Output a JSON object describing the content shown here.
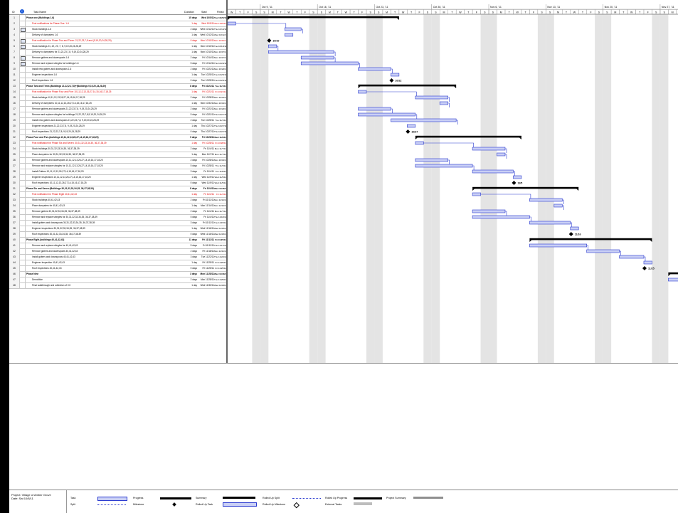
{
  "header": {
    "id": "ID",
    "task_name": "Task Name",
    "duration": "Duration",
    "start": "Start",
    "finish": "Finish"
  },
  "timescale": {
    "weeks": [
      "Oct 9, '11",
      "Oct 16, '11",
      "Oct 23, '11",
      "Oct 30, '11",
      "Nov 6, '11",
      "Nov 13, '11",
      "Nov 20, '11",
      "Nov 27, '11"
    ],
    "day_letters": [
      "W",
      "T",
      "F",
      "S",
      "S",
      "M",
      "T",
      "W",
      "T",
      "F",
      "S",
      "S",
      "M",
      "T",
      "W",
      "T",
      "F",
      "S",
      "S",
      "M",
      "T",
      "W",
      "T",
      "F",
      "S",
      "S",
      "M",
      "T",
      "W",
      "T",
      "F",
      "S",
      "S",
      "M",
      "T",
      "W",
      "T",
      "F",
      "S",
      "S",
      "M",
      "T",
      "W",
      "T",
      "F",
      "S",
      "S",
      "M",
      "T",
      "W",
      "T",
      "F",
      "S",
      "S",
      "M",
      "T",
      "W"
    ]
  },
  "tasks": [
    {
      "id": "1",
      "name": "Phase one-(Buildings 1-6)",
      "dur": "15 days",
      "start": "Wed 10/5/11",
      "finish": "Tue 10/25/11",
      "type": "summary",
      "indent": 0,
      "icon": false
    },
    {
      "id": "2",
      "name": "Post notifications for Phase One. 1-6",
      "dur": "1 day",
      "start": "Wed 10/5/11",
      "finish": "Wed 10/5/11",
      "type": "red",
      "indent": 1,
      "icon": false
    },
    {
      "id": "3",
      "name": "Stock buildings 1-6",
      "dur": "2 days",
      "start": "Wed 10/12/11",
      "finish": "Thu 10/13/11",
      "type": "task",
      "indent": 1,
      "icon": true
    },
    {
      "id": "4",
      "name": "Delivery of dumpsters 1-6",
      "dur": "1 day",
      "start": "Wed 10/12/11",
      "finish": "Wed 10/12/11",
      "type": "task",
      "indent": 1,
      "icon": false
    },
    {
      "id": "5",
      "name": "Post notification for Phase Two and Three: 21,22,23,7,8 and (9,19,20,24,28,29)",
      "dur": "0 days",
      "start": "Mon 10/10/11",
      "finish": "Mon 10/10/11",
      "type": "red",
      "indent": 1,
      "icon": true
    },
    {
      "id": "6",
      "name": "Stock buildings 21, 22, 23, 7, 8, 9,19,20,24,28,29",
      "dur": "1 day",
      "start": "Mon 10/10/11",
      "finish": "Tue 10/10/11",
      "type": "task",
      "indent": 1,
      "icon": true
    },
    {
      "id": "7",
      "name": "Delivery fo dumpsters for 21,22,23,7,8, 9,19,20,24,28,29",
      "dur": "1 day",
      "start": "Mon 10/10/11",
      "finish": "Mon 10/17/11",
      "type": "task",
      "indent": 1,
      "icon": false
    },
    {
      "id": "8",
      "name": "Remove gutters and downspouts 1-6",
      "dur": "2 days",
      "start": "Fri 10/14/11",
      "finish": "Mon 10/17/11",
      "type": "task",
      "indent": 1,
      "icon": true
    },
    {
      "id": "9",
      "name": "Remove and replace shingles for buildings 1-6",
      "dur": "5 days",
      "start": "Fri 10/14/11",
      "finish": "Thu 10/20/11",
      "type": "task",
      "indent": 1,
      "icon": true
    },
    {
      "id": "10",
      "name": "Install new gutters and downspouts 1-6",
      "dur": "2 days",
      "start": "Fri 10/21/11",
      "finish": "Mon 10/24/11",
      "type": "task",
      "indent": 1,
      "icon": false
    },
    {
      "id": "11",
      "name": "Engineer inspections 1-6",
      "dur": "1 day",
      "start": "Tue 10/25/11",
      "finish": "Tue 10/25/11",
      "type": "task",
      "indent": 1,
      "icon": false
    },
    {
      "id": "12",
      "name": "Roof Inspections 1-6",
      "dur": "0 days",
      "start": "Tue 10/25/11",
      "finish": "Tue 10/25/11",
      "type": "task",
      "indent": 1,
      "icon": false
    },
    {
      "id": "13",
      "name": "Phase Two and Three-(Buildings 21,22,23,7,8)+(Buildings 9,19,20,24,28,29)",
      "dur": "8 days",
      "start": "Fri 10/21/11",
      "finish": "Tue 11/1/11",
      "type": "summary",
      "indent": 0,
      "icon": false
    },
    {
      "id": "14",
      "name": "Post notification for Phase Four and Five: 10,11,12,13,26,27,14,15,16,17,18,25",
      "dur": "1 day",
      "start": "Fri 10/21/11",
      "finish": "Fri 10/21/11",
      "type": "red",
      "indent": 1,
      "icon": false
    },
    {
      "id": "15",
      "name": "Stock buildings 10,11,12,13,26,27,14,15,16,17,18,25",
      "dur": "2 days",
      "start": "Fri 10/28/11",
      "finish": "Mon 10/31/11",
      "type": "task",
      "indent": 1,
      "icon": false
    },
    {
      "id": "16",
      "name": "Delivery of dumpsters 10,11,12,13,26,27,14,15,16,17,18,25",
      "dur": "1 day",
      "start": "Mon 10/31/11",
      "finish": "Mon 10/31/11",
      "type": "task",
      "indent": 1,
      "icon": false
    },
    {
      "id": "17",
      "name": "Remove gutters and downspouts 21,22,23,7,8, 9,19,20,24,28,29",
      "dur": "2 days",
      "start": "Fri 10/21/11",
      "finish": "Mon 10/24/11",
      "type": "task",
      "indent": 1,
      "icon": false
    },
    {
      "id": "18",
      "name": "Remove and replace shingles for buildings 21,22,23,7,8,9,19,20,24,28,29",
      "dur": "5 days",
      "start": "Fri 10/21/11",
      "finish": "Thu 10/27/11",
      "type": "task",
      "indent": 1,
      "icon": false
    },
    {
      "id": "19",
      "name": "Install new gutters and downspouts 21,22,23,7,8, 9,19,20,24,28,29",
      "dur": "2 days",
      "start": "Tue 10/25/11",
      "finish": "Tue 11/1/11",
      "type": "task",
      "indent": 1,
      "icon": false
    },
    {
      "id": "20",
      "name": "Engineer inspections 21,22,23,7,8, 9,19,20,24,28,29",
      "dur": "1 day",
      "start": "Thu 10/27/11",
      "finish": "Thu 10/27/11",
      "type": "task",
      "indent": 1,
      "icon": false
    },
    {
      "id": "21",
      "name": "Roof Inspections 21,22,23,7,8, 9,19,20,24,28,29",
      "dur": "0 days",
      "start": "Thu 10/27/11",
      "finish": "Thu 10/27/11",
      "type": "task",
      "indent": 1,
      "icon": false
    },
    {
      "id": "22",
      "name": "Phase Four and Five-(buildings 10,11,12,13,26,27,14,15,16,17,18,25)",
      "dur": "9 days",
      "start": "Fri 10/28/11",
      "finish": "Wed 11/9/11",
      "type": "summary",
      "indent": 0,
      "icon": false
    },
    {
      "id": "23",
      "name": "Post notification for Phase Six and Seven: 30,31,32,33,34,35, 36,37,38,39",
      "dur": "1 day",
      "start": "Fri 10/28/11",
      "finish": "Fri 10/28/11",
      "type": "red",
      "indent": 1,
      "icon": false
    },
    {
      "id": "24",
      "name": "Stock buildings 30,31,32,33,34,35, 36,37,38,39",
      "dur": "2 days",
      "start": "Fri 11/4/11",
      "finish": "Mon 11/7/11",
      "type": "task",
      "indent": 1,
      "icon": false
    },
    {
      "id": "25",
      "name": "Place dumpsters for 30,31,32,33,34,35, 36,37,38,39",
      "dur": "1 day",
      "start": "Mon 11/7/11",
      "finish": "Mon 11/7/11",
      "type": "task",
      "indent": 1,
      "icon": false
    },
    {
      "id": "26",
      "name": "Remove gutters and downspouts  10,11,12,13,26,27,14,15,16,17,18,25",
      "dur": "2 days",
      "start": "Fri 10/28/11",
      "finish": "Mon 10/31/11",
      "type": "task",
      "indent": 1,
      "icon": false
    },
    {
      "id": "27",
      "name": "Remove and replace shingles for 10,11,12,13,26,27,14,15,16,17,18,25",
      "dur": "5 days",
      "start": "Fri 10/28/11",
      "finish": "Thu 11/3/11",
      "type": "task",
      "indent": 1,
      "icon": false
    },
    {
      "id": "28",
      "name": "Install Gutters  10,11,12,13,26,27,14,15,16,17,18,25",
      "dur": "3 days",
      "start": "Fri 11/4/11",
      "finish": "Tue 11/8/11",
      "type": "task",
      "indent": 1,
      "icon": false
    },
    {
      "id": "29",
      "name": "Engineer inspections  10,11,12,13,26,27,14,15,16,17,18,25",
      "dur": "1 day",
      "start": "Wed 11/9/11",
      "finish": "Wed 11/9/11",
      "type": "task",
      "indent": 1,
      "icon": false
    },
    {
      "id": "30",
      "name": "Roof Inspections  10,11,12,13,26,27,14,15,16,17,18,25",
      "dur": "0 days",
      "start": "Wed 11/9/11",
      "finish": "Wed 11/9/11",
      "type": "task",
      "indent": 1,
      "icon": false
    },
    {
      "id": "31",
      "name": "Phase Six and Seven-(Buildings 30,31,32,33,34,35, 36,37,38,39)",
      "dur": "8 days",
      "start": "Fri 11/4/11",
      "finish": "Wed 11/16/11",
      "type": "summary",
      "indent": 0,
      "icon": false
    },
    {
      "id": "32",
      "name": "Post notification for Phase Eight 40,41,42,43",
      "dur": "1 day",
      "start": "Fri 11/4/11",
      "finish": "Fri 11/4/11",
      "type": "red",
      "indent": 1,
      "icon": false
    },
    {
      "id": "33",
      "name": "Stock buildings 40,41,42,43",
      "dur": "2 days",
      "start": "Fri 11/11/11",
      "finish": "Mon 11/14/11",
      "type": "task",
      "indent": 1,
      "icon": false
    },
    {
      "id": "34",
      "name": "Place dumpsters for 40,41,42,43",
      "dur": "1 day",
      "start": "Mon 11/14/11",
      "finish": "Mon 11/14/11",
      "type": "task",
      "indent": 1,
      "icon": false
    },
    {
      "id": "35",
      "name": "Remove gutters 30,31,32,33,34,35, 36,37,38,39",
      "dur": "2 days",
      "start": "Fri 11/4/11",
      "finish": "Mon 11/7/11",
      "type": "task",
      "indent": 1,
      "icon": false
    },
    {
      "id": "36",
      "name": "Remove and replace shingles for 30,31,32,33,34,35, 36,37,38,39",
      "dur": "5 days",
      "start": "Fri 11/4/11",
      "finish": "Thu 11/10/11",
      "type": "task",
      "indent": 1,
      "icon": false
    },
    {
      "id": "37",
      "name": "Install gutters and downspouts 30,31,32,33,34,35, 36,37,38,39",
      "dur": "3 days",
      "start": "Fri 11/11/11",
      "finish": "Tue 11/15/11",
      "type": "task",
      "indent": 1,
      "icon": false
    },
    {
      "id": "38",
      "name": "Engineer inspections 30,31,32,33,34,35, 36,37,38,39",
      "dur": "1 day",
      "start": "Wed 11/16/11",
      "finish": "Wed 11/16/11",
      "type": "task",
      "indent": 1,
      "icon": false
    },
    {
      "id": "39",
      "name": "Roof Inspections 30,31,32,33,34,35, 36,37,38,39",
      "dur": "0 days",
      "start": "Wed 11/16/11",
      "finish": "Wed 11/16/11",
      "type": "task",
      "indent": 1,
      "icon": false
    },
    {
      "id": "40",
      "name": "Phase Eight-(buildings 40,41,42,43)",
      "dur": "11 days",
      "start": "Fri 11/11/11",
      "finish": "Fri 11/25/11",
      "type": "summary",
      "indent": 0,
      "icon": false
    },
    {
      "id": "41",
      "name": "Remove and replace shingles for 40,41,42,43",
      "dur": "5 days",
      "start": "Fri 11/11/11",
      "finish": "Thu 11/17/11",
      "type": "task",
      "indent": 1,
      "icon": false
    },
    {
      "id": "42",
      "name": "Remove gutters and downspouts 40,41,42,43",
      "dur": "2 days",
      "start": "Fri 11/18/11",
      "finish": "Mon 11/21/11",
      "type": "task",
      "indent": 1,
      "icon": false
    },
    {
      "id": "43",
      "name": "Install gutters and downspouts 40,41,42,43",
      "dur": "3 days",
      "start": "Tue 11/22/11",
      "finish": "Thu 11/24/11",
      "type": "task",
      "indent": 1,
      "icon": false
    },
    {
      "id": "44",
      "name": "Engineer Inspection  40,41,42,43",
      "dur": "1 day",
      "start": "Fri 11/25/11",
      "finish": "Fri 11/25/11",
      "type": "task",
      "indent": 1,
      "icon": false
    },
    {
      "id": "45",
      "name": "Roof Inspections  40,41,42,43",
      "dur": "0 days",
      "start": "Fri 11/25/11",
      "finish": "Fri 11/25/11",
      "type": "task",
      "indent": 1,
      "icon": false
    },
    {
      "id": "46",
      "name": "Phase Nine",
      "dur": "3 days",
      "start": "Mon 11/28/11",
      "finish": "Wed 11/30/11",
      "type": "summary",
      "indent": 0,
      "icon": false
    },
    {
      "id": "47",
      "name": "Demolitize",
      "dur": "2 days",
      "start": "Mon 11/28/11",
      "finish": "Tue 11/29/11",
      "type": "task",
      "indent": 1,
      "icon": false
    },
    {
      "id": "48",
      "name": "Final walkthrough and collection of CC",
      "dur": "1 day",
      "start": "Wed 11/30/11",
      "finish": "Wed 11/30/11",
      "type": "task",
      "indent": 1,
      "icon": false
    }
  ],
  "milestones": [
    {
      "row": 4,
      "label": "10/10"
    },
    {
      "row": 11,
      "label": "10/22"
    },
    {
      "row": 20,
      "label": "10/27"
    },
    {
      "row": 29,
      "label": "11/5"
    },
    {
      "row": 38,
      "label": "11/16"
    },
    {
      "row": 44,
      "label": "11/25"
    }
  ],
  "legend": {
    "project": "Project: Village of Amber Grove",
    "date": "Date: Sat 10/8/11",
    "items": {
      "task": "Task",
      "split": "Split",
      "progress": "Progress",
      "milestone": "Milestone",
      "summary": "Summary",
      "rolled_task": "Rolled Up Task",
      "rolled_split": "Rolled Up Split",
      "rolled_milestone": "Rolled Up Milestone",
      "rolled_progress": "Rolled Up Progress",
      "external": "External Tasks",
      "project_summary": "Project Summary"
    }
  },
  "colors": {
    "bar_fill": "#c9cff5",
    "bar_stroke": "#2b3bd0",
    "red_text": "#e60000",
    "weekend_shade": "#e4e4e4"
  }
}
